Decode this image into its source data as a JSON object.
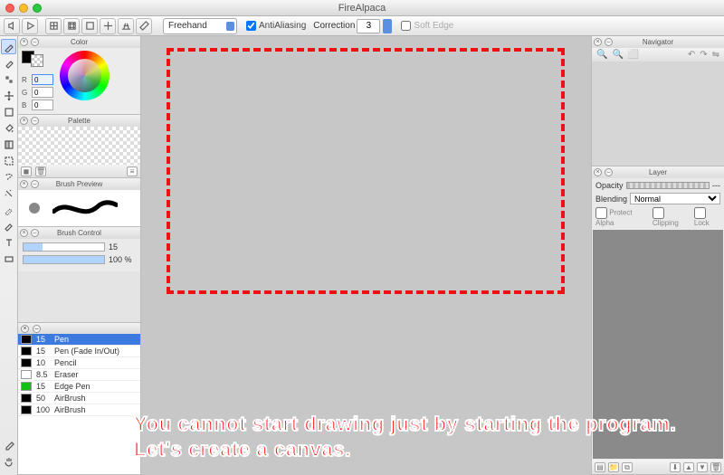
{
  "app": {
    "title": "FireAlpaca"
  },
  "optionbar": {
    "mode": "Freehand",
    "antialias_label": "AntiAliasing",
    "antialias_checked": true,
    "correction_label": "Correction",
    "correction_value": "3",
    "softedge_label": "Soft Edge",
    "softedge_checked": false
  },
  "panels": {
    "color": {
      "title": "Color",
      "r": "0",
      "g": "0",
      "b": "0"
    },
    "palette": {
      "title": "Palette"
    },
    "brush_preview": {
      "title": "Brush Preview"
    },
    "brush_control": {
      "title": "Brush Control",
      "size_value": "15",
      "opacity_value": "100 %"
    },
    "navigator": {
      "title": "Navigator"
    },
    "layer": {
      "title": "Layer",
      "opacity_label": "Opacity",
      "opacity_display": "---",
      "blending_label": "Blending",
      "blending_value": "Normal",
      "protect_label": "Protect Alpha",
      "clipping_label": "Clipping",
      "lock_label": "Lock"
    }
  },
  "brushes": [
    {
      "size": "15",
      "name": "Pen",
      "swatch": "#000",
      "selected": true
    },
    {
      "size": "15",
      "name": "Pen (Fade In/Out)",
      "swatch": "#000",
      "selected": false
    },
    {
      "size": "10",
      "name": "Pencil",
      "swatch": "#000",
      "selected": false
    },
    {
      "size": "8.5",
      "name": "Eraser",
      "swatch": "#fff",
      "selected": false
    },
    {
      "size": "15",
      "name": "Edge Pen",
      "swatch": "#13c016",
      "selected": false
    },
    {
      "size": "50",
      "name": "AirBrush",
      "swatch": "#000",
      "selected": false
    },
    {
      "size": "100",
      "name": "AirBrush",
      "swatch": "#000",
      "selected": false
    }
  ],
  "annotation": "You cannot start drawing just by starting the program.\nLet's create a canvas."
}
